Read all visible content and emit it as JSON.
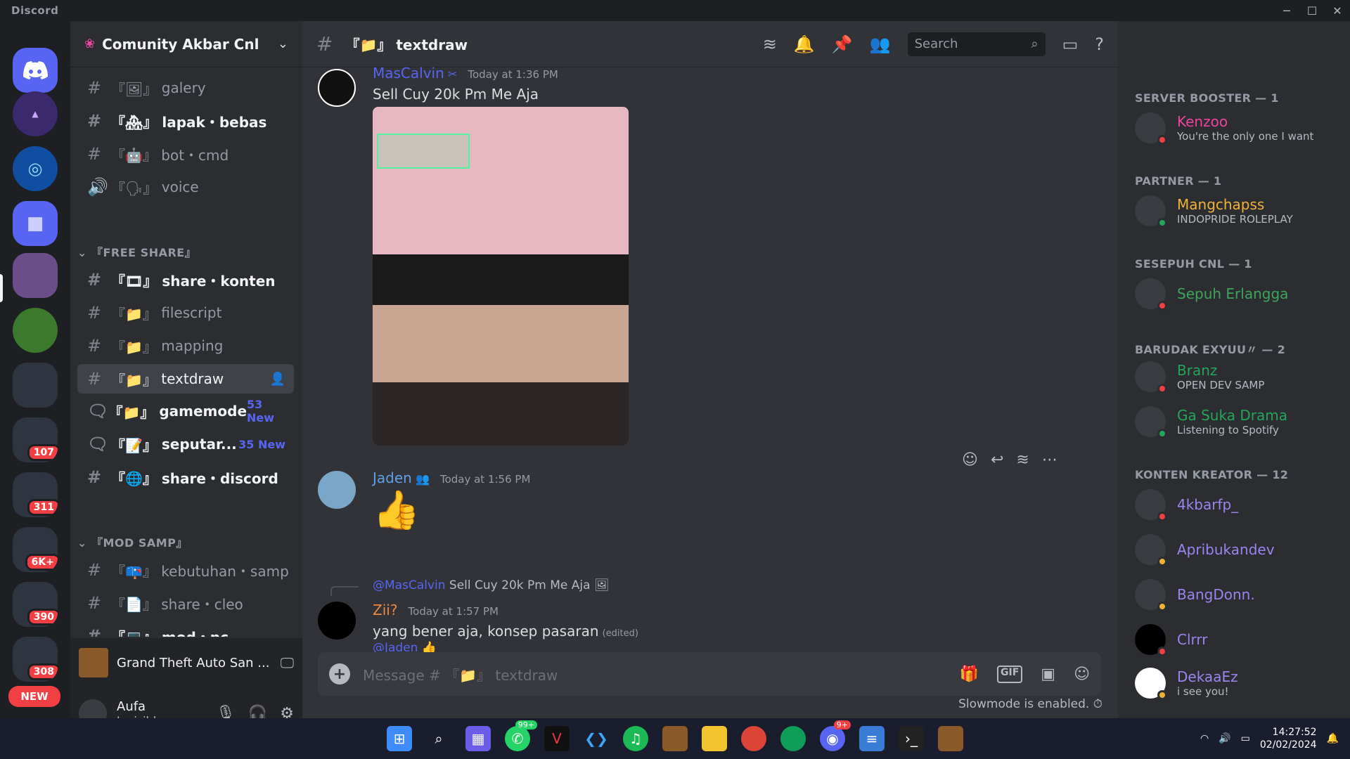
{
  "app": {
    "brand": "Discord"
  },
  "window": {
    "minimize": "─",
    "maximize": "☐",
    "close": "✕"
  },
  "guilds": [
    {
      "badge": ""
    },
    {
      "badge": ""
    },
    {
      "badge": ""
    },
    {
      "badge": ""
    },
    {
      "badge": ""
    },
    {
      "badge": ""
    },
    {
      "badge": ""
    },
    {
      "badge": "107"
    },
    {
      "badge": "311"
    },
    {
      "badge": "6K+"
    },
    {
      "badge": "390"
    },
    {
      "badge": "308"
    }
  ],
  "guild_new_label": "NEW",
  "server": {
    "name": "Comunity Akbar Cnl"
  },
  "channels": [
    {
      "prefix": "『🖼』",
      "name": "galery"
    },
    {
      "prefix": "『🏘』",
      "name": "lapak・bebas"
    },
    {
      "prefix": "『🤖』",
      "name": "bot・cmd"
    },
    {
      "prefix": "『🗣』",
      "name": "voice"
    }
  ],
  "category_free": "『FREE SHARE』",
  "channels_free": [
    {
      "prefix": "『🎞』",
      "name": "share・konten"
    },
    {
      "prefix": "『📁』",
      "name": "filescript"
    },
    {
      "prefix": "『📁』",
      "name": "mapping"
    },
    {
      "prefix": "『📁』",
      "name": "textdraw"
    },
    {
      "prefix": "『📁』",
      "name": "gamemode",
      "new": "53 New"
    },
    {
      "prefix": "『📝』",
      "name": "seputar...",
      "new": "35 New"
    },
    {
      "prefix": "『🌐』",
      "name": "share・discord"
    }
  ],
  "category_mod": "『MOD SAMP』",
  "channels_mod": [
    {
      "prefix": "『📪』",
      "name": "kebutuhan・samp"
    },
    {
      "prefix": "『📄』",
      "name": "share・cleo"
    },
    {
      "prefix": "『💻』",
      "name": "mod・pc"
    }
  ],
  "activity": {
    "label": "Grand Theft Auto San ..."
  },
  "user": {
    "name": "Aufa",
    "status": "Invisible"
  },
  "chat": {
    "channel_prefix": "『📁』",
    "channel_name": "textdraw",
    "search_placeholder": "Search",
    "messages": [
      {
        "author": "MasCalvin",
        "time": "Today at 1:36 PM",
        "text": "Sell Cuy 20k Pm Me Aja"
      },
      {
        "author": "Jaden",
        "time": "Today at 1:56 PM",
        "text": "👍"
      },
      {
        "reply_author": "@MasCalvin",
        "reply_text": "Sell Cuy 20k Pm Me Aja",
        "author": "Zii?",
        "time": "Today at 1:57 PM",
        "text": "yang bener aja, konsep pasaran",
        "edited": "(edited)"
      },
      {
        "reply_author": "@Jaden",
        "reply_text": "👍"
      }
    ],
    "composer_placeholder": "Message # 『📁』 textdraw",
    "slowmode": "Slowmode is enabled."
  },
  "members": {
    "categories": [
      {
        "label": "SERVER BOOSTER — 1"
      },
      {
        "label": "PARTNER — 1"
      },
      {
        "label": "SESEPUH CNL — 1"
      },
      {
        "label": "BARUDAK EXYUU〃 — 2"
      },
      {
        "label": "KONTEN KREATOR — 12"
      }
    ],
    "list": [
      {
        "name": "Kenzoo",
        "status": "You're the only one I want",
        "color": "#eb459e"
      },
      {
        "name": "Mangchapss",
        "status": "INDOPRIDE ROLEPLAY",
        "color": "#f0b232"
      },
      {
        "name": "Sepuh Erlangga",
        "status": "",
        "color": "#3ba55c"
      },
      {
        "name": "Branz",
        "status": "OPEN DEV SAMP",
        "color": "#23a55a"
      },
      {
        "name": "Ga Suka Drama",
        "status": "Listening to Spotify",
        "color": "#23a55a"
      },
      {
        "name": "4kbarfp_",
        "status": "",
        "color": "#9b84ee"
      },
      {
        "name": "Apribukandev",
        "status": "",
        "color": "#9b84ee"
      },
      {
        "name": "BangDonn.",
        "status": "",
        "color": "#9b84ee"
      },
      {
        "name": "Clrrr",
        "status": "",
        "color": "#9b84ee"
      },
      {
        "name": "DekaaEz",
        "status": "i see you!",
        "color": "#9b84ee"
      }
    ]
  },
  "taskbar": {
    "whatsapp_badge": "99+",
    "discord_badge": "9+",
    "time": "14:27:52",
    "date": "02/02/2024"
  },
  "colors": {
    "accent": "#5865f2",
    "danger": "#f23f43",
    "bg": "#313338"
  }
}
